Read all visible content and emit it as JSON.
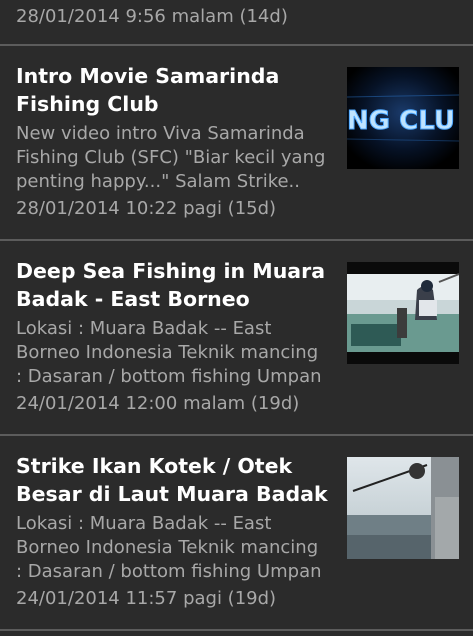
{
  "top_item": {
    "date": "28/01/2014 9:56 malam (14d)"
  },
  "items": [
    {
      "title": "Intro Movie Samarinda Fishing Club",
      "description": "New video intro Viva Samarinda\nFishing Club (SFC) \"Biar kecil yang\npenting happy...\" Salam Strike..",
      "date": "28/01/2014 10:22 pagi (15d)",
      "thumbnail": "video-thumbnail-intro-movie",
      "thumbnail_text": "NG CLU"
    },
    {
      "title": "Deep Sea Fishing in Muara Badak - East Borneo",
      "description": "Lokasi : Muara Badak -- East\nBorneo Indonesia Teknik mancing\n: Dasaran / bottom fishing Umpan",
      "date": "24/01/2014 12:00 malam (19d)",
      "thumbnail": "video-thumbnail-boat-deck"
    },
    {
      "title": "Strike Ikan Kotek / Otek Besar di Laut Muara Badak",
      "description": "Lokasi : Muara Badak -- East\nBorneo Indonesia Teknik mancing\n: Dasaran / bottom fishing Umpan",
      "date": "24/01/2014 11:57 pagi (19d)",
      "thumbnail": "video-thumbnail-fishing-rod-sea"
    }
  ],
  "colors": {
    "background": "#2b2b2b",
    "divider": "#5c5c5c",
    "title": "#ffffff",
    "secondary_text": "#a8a8a8",
    "thumb_glow": "#4fa8ff"
  }
}
